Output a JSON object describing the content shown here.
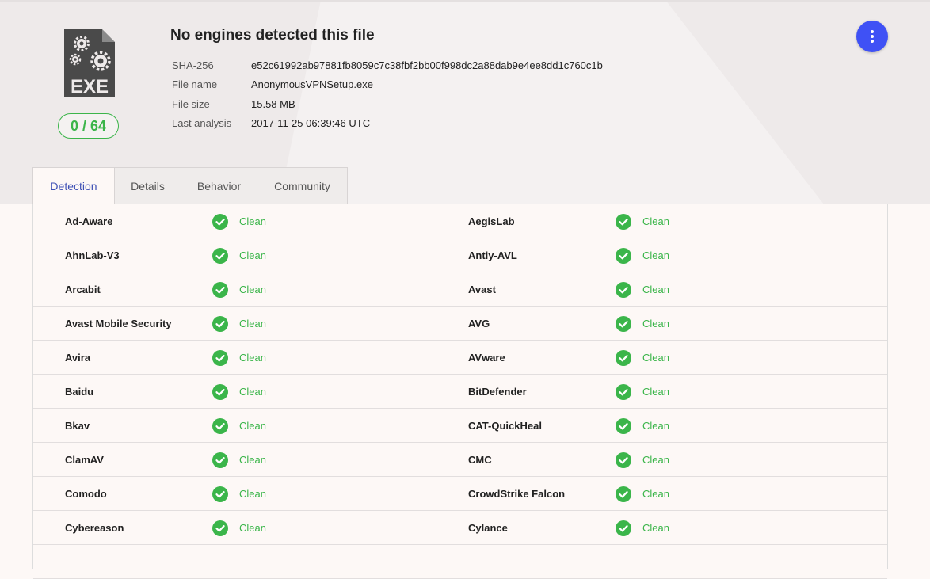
{
  "file": {
    "icon_label": "EXE",
    "score": "0 / 64",
    "title": "No engines detected this file",
    "meta": [
      {
        "key": "SHA-256",
        "value": "e52c61992ab97881fb8059c7c38fbf2bb00f998dc2a88dab9e4ee8dd1c760c1b"
      },
      {
        "key": "File name",
        "value": "AnonymousVPNSetup.exe"
      },
      {
        "key": "File size",
        "value": "15.58 MB"
      },
      {
        "key": "Last analysis",
        "value": "2017-11-25 06:39:46 UTC"
      }
    ]
  },
  "tabs": [
    {
      "label": "Detection",
      "active": true
    },
    {
      "label": "Details",
      "active": false
    },
    {
      "label": "Behavior",
      "active": false
    },
    {
      "label": "Community",
      "active": false
    }
  ],
  "colors": {
    "accent": "#3f51f5",
    "clean": "#3bb54a"
  },
  "detections": [
    {
      "left": {
        "engine": "Ad-Aware",
        "result": "Clean"
      },
      "right": {
        "engine": "AegisLab",
        "result": "Clean"
      }
    },
    {
      "left": {
        "engine": "AhnLab-V3",
        "result": "Clean"
      },
      "right": {
        "engine": "Antiy-AVL",
        "result": "Clean"
      }
    },
    {
      "left": {
        "engine": "Arcabit",
        "result": "Clean"
      },
      "right": {
        "engine": "Avast",
        "result": "Clean"
      }
    },
    {
      "left": {
        "engine": "Avast Mobile Security",
        "result": "Clean"
      },
      "right": {
        "engine": "AVG",
        "result": "Clean"
      }
    },
    {
      "left": {
        "engine": "Avira",
        "result": "Clean"
      },
      "right": {
        "engine": "AVware",
        "result": "Clean"
      }
    },
    {
      "left": {
        "engine": "Baidu",
        "result": "Clean"
      },
      "right": {
        "engine": "BitDefender",
        "result": "Clean"
      }
    },
    {
      "left": {
        "engine": "Bkav",
        "result": "Clean"
      },
      "right": {
        "engine": "CAT-QuickHeal",
        "result": "Clean"
      }
    },
    {
      "left": {
        "engine": "ClamAV",
        "result": "Clean"
      },
      "right": {
        "engine": "CMC",
        "result": "Clean"
      }
    },
    {
      "left": {
        "engine": "Comodo",
        "result": "Clean"
      },
      "right": {
        "engine": "CrowdStrike Falcon",
        "result": "Clean"
      }
    },
    {
      "left": {
        "engine": "Cybereason",
        "result": "Clean"
      },
      "right": {
        "engine": "Cylance",
        "result": "Clean"
      }
    }
  ]
}
